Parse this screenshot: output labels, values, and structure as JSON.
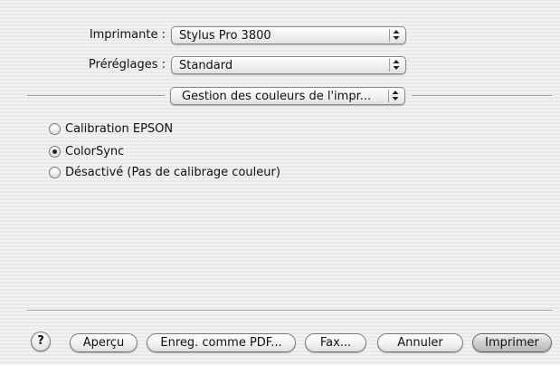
{
  "printer": {
    "label": "Imprimante :",
    "value": "Stylus Pro 3800"
  },
  "presets": {
    "label": "Préréglages :",
    "value": "Standard"
  },
  "panel": {
    "value": "Gestion des couleurs de l'impr..."
  },
  "color_options": [
    {
      "label": "Calibration EPSON",
      "selected": false
    },
    {
      "label": "ColorSync",
      "selected": true
    },
    {
      "label": "Désactivé (Pas de calibrage couleur)",
      "selected": false
    }
  ],
  "buttons": {
    "help": "?",
    "preview": "Aperçu",
    "save_pdf": "Enreg. comme PDF...",
    "fax": "Fax...",
    "cancel": "Annuler",
    "print": "Imprimer"
  }
}
